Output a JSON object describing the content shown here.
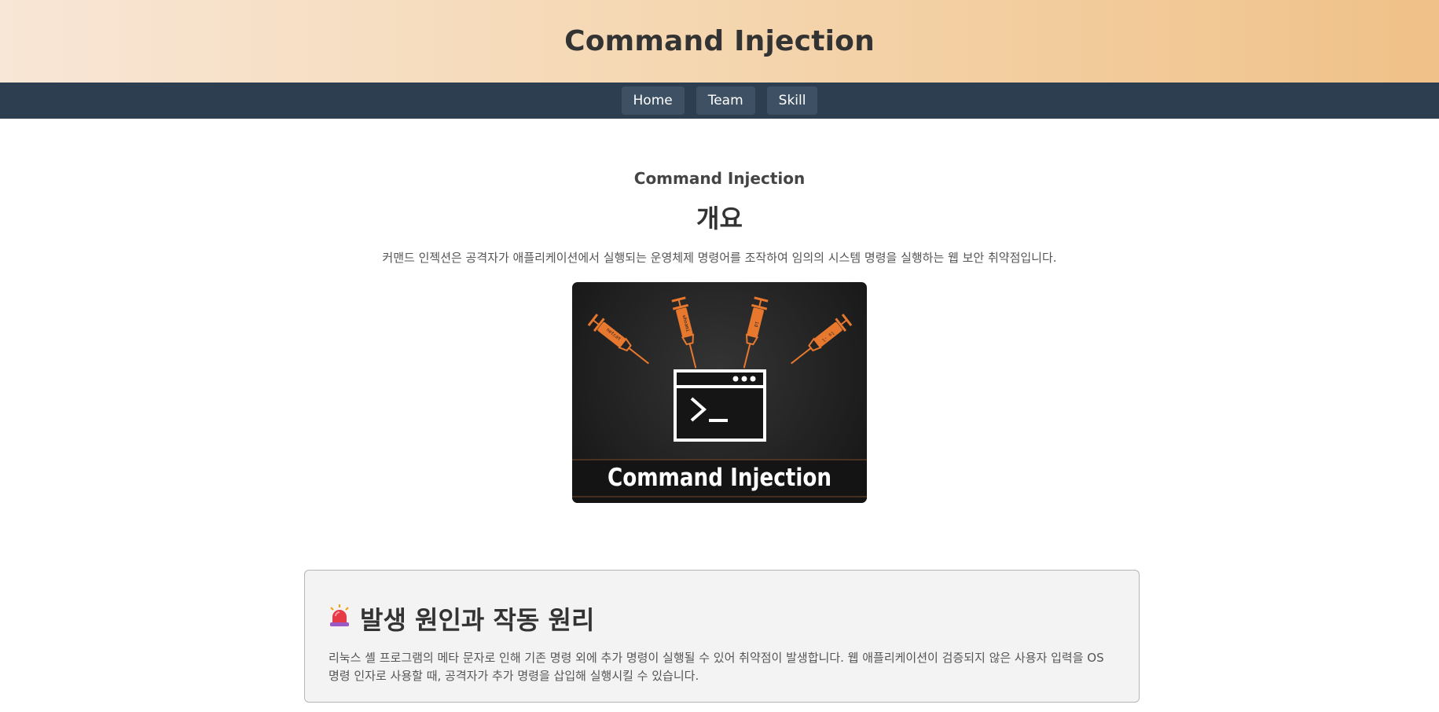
{
  "header": {
    "title": "Command Injection"
  },
  "nav": {
    "items": [
      {
        "label": "Home"
      },
      {
        "label": "Team"
      },
      {
        "label": "Skill"
      }
    ]
  },
  "overview": {
    "kicker": "Command Injection",
    "title": "개요",
    "description": "커맨드 인젝션은 공격자가 애플리케이션에서 실행되는 운영체제 명령어를 조작하여 임의의 시스템 명령을 실행하는 웹 보안 취약점입니다.",
    "image": {
      "caption": "Command Injection",
      "icon": "terminal-icon",
      "syringe_labels": [
        "netcat",
        "whoami",
        "id",
        "ls -l"
      ]
    }
  },
  "cause_section": {
    "icon": "siren-icon",
    "title": "발생 원인과 작동 원리",
    "body": "리눅스 셸 프로그램의 메타 문자로 인해 기존 명령 외에 추가 명령이 실행될 수 있어 취약점이 발생합니다. 웹 애플리케이션이 검증되지 않은 사용자 입력을 OS 명령 인자로 사용할 때, 공격자가 추가 명령을 삽입해 실행시킬 수 있습니다."
  },
  "colors": {
    "header_gradient_start": "#f8e6d6",
    "header_gradient_end": "#f0c188",
    "nav_background": "#2d3e50",
    "nav_button": "#3e5064",
    "accent_orange": "#e8782e",
    "card_background": "#f3f3f3"
  }
}
